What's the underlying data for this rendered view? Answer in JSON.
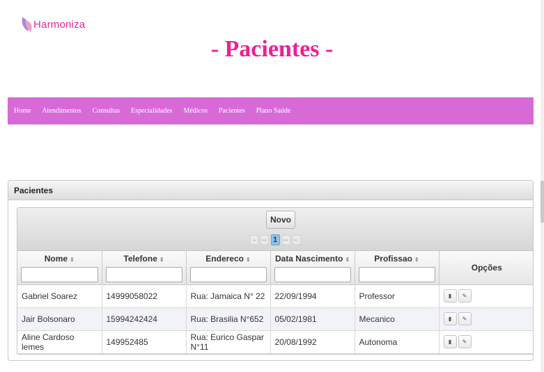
{
  "brand": {
    "name": "Harmoniza",
    "color": "#e6259a"
  },
  "page_title": "- Pacientes -",
  "nav": {
    "color": "#d86ad8",
    "items": [
      "Home",
      "Atendimentos",
      "Consultas",
      "Especialidades",
      "Médicos",
      "Pacientes",
      "Plano Saúde"
    ]
  },
  "panel": {
    "title": "Pacientes"
  },
  "table": {
    "new_button": "Novo",
    "paginator": {
      "current_page": "1",
      "first_icon": "first-page-icon",
      "prev_icon": "prev-page-icon",
      "next_icon": "next-page-icon",
      "last_icon": "last-page-icon"
    },
    "columns": [
      "Nome",
      "Telefone",
      "Endereco",
      "Data Nascimento",
      "Profissao",
      "Opções"
    ],
    "filter_values": [
      "",
      "",
      "",
      "",
      ""
    ],
    "rows": [
      {
        "nome": "Gabriel Soarez",
        "telefone": "14999058022",
        "endereco": "Rua: Jamaica N° 22",
        "nascimento": "22/09/1994",
        "profissao": "Professor"
      },
      {
        "nome": "Jair Bolsonaro",
        "telefone": "15994242424",
        "endereco": "Rua: Brasilia N°652",
        "nascimento": "05/02/1981",
        "profissao": "Mecanico"
      },
      {
        "nome": "Aline Cardoso lemes",
        "telefone": "149952485",
        "endereco": "Rua: Eurico Gaspar N°11",
        "nascimento": "20/08/1992",
        "profissao": "Autonoma"
      }
    ],
    "row_actions": {
      "delete_icon": "trash-icon",
      "edit_icon": "pencil-icon"
    }
  }
}
